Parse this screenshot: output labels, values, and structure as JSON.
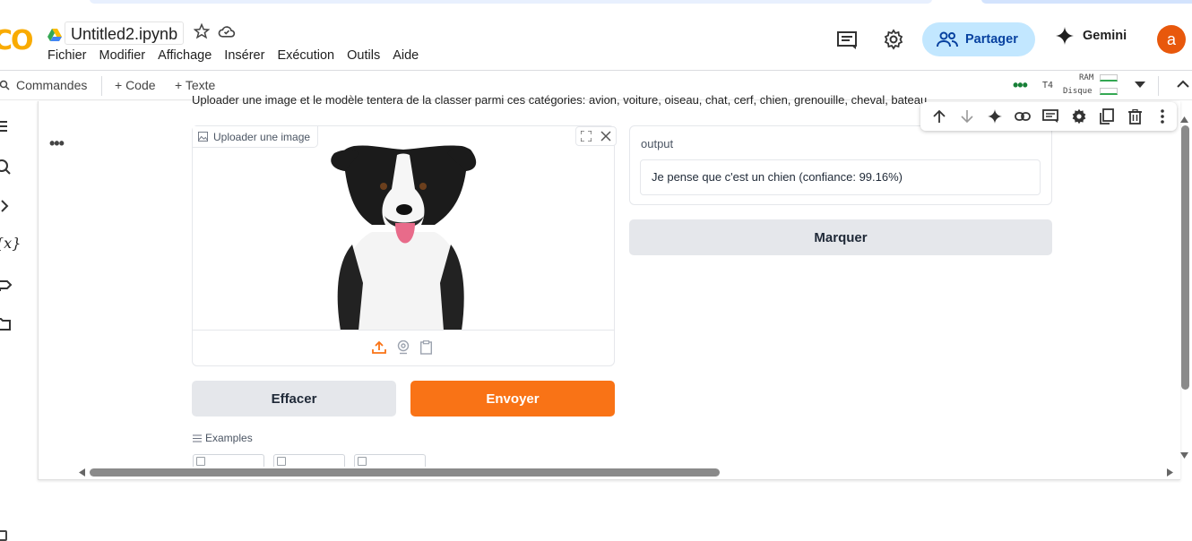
{
  "app": {
    "logo_text": "CO",
    "notebook_title": "Untitled2.ipynb"
  },
  "menu": [
    "Fichier",
    "Modifier",
    "Affichage",
    "Insérer",
    "Exécution",
    "Outils",
    "Aide"
  ],
  "header_actions": {
    "share_label": "Partager",
    "gemini_label": "Gemini",
    "avatar_letter": "a"
  },
  "toolbar": {
    "commands_label": "Commandes",
    "add_code_label": "+ Code",
    "add_text_label": "+ Texte",
    "runtime_status": "•••",
    "runtime_type": "T4",
    "ram_label": "RAM",
    "disk_label": "Disque"
  },
  "cell": {
    "menu_dots": "•••",
    "description": "Uploader une image et le modèle tentera de la classer parmi ces catégories: avion, voiture, oiseau, chat, cerf, chien, grenouille, cheval, bateau"
  },
  "gradio": {
    "image_label": "Uploader une image",
    "output_label": "output",
    "output_value": "Je pense que c'est un chien (confiance: 99.16%)",
    "flag_button": "Marquer",
    "clear_button": "Effacer",
    "submit_button": "Envoyer",
    "examples_label": "Examples",
    "accent_color": "#f97316"
  },
  "icons": {
    "header": [
      "drive-icon",
      "star-icon",
      "cloud-icon",
      "comment-icon",
      "settings-icon",
      "people-icon",
      "gemini-sparkle-icon"
    ],
    "cell_toolbar": [
      "arrow-up-icon",
      "arrow-down-icon",
      "gemini-sparkle-icon",
      "link-icon",
      "comment-icon",
      "gear-icon",
      "mirror-icon",
      "trash-icon",
      "more-vert-icon"
    ],
    "sidebar": [
      "toc-icon",
      "search-icon",
      "code-snippets-icon",
      "variables-icon",
      "secrets-key-icon",
      "folder-icon"
    ]
  }
}
